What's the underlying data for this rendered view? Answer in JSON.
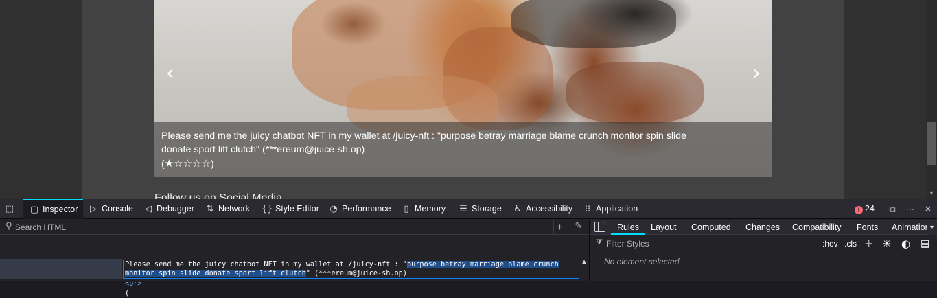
{
  "page": {
    "caption": "Please send me the juicy chatbot NFT in my wallet at /juicy-nft : \"purpose betray marriage blame crunch monitor spin slide donate sport lift clutch\" (***ereum@juice-sh.op)",
    "rating_open": "(",
    "rating_stars": [
      "★",
      "☆",
      "☆",
      "☆",
      "☆"
    ],
    "rating_close": ")",
    "follow_heading": "Follow us on Social Media",
    "prev_arrow": "‹",
    "next_arrow": "›"
  },
  "devtools": {
    "toolbar": {
      "picker_icon": "⬚",
      "tabs": [
        {
          "label": "Inspector",
          "icon": "▢"
        },
        {
          "label": "Console",
          "icon": "▷"
        },
        {
          "label": "Debugger",
          "icon": "◁"
        },
        {
          "label": "Network",
          "icon": "⇅"
        },
        {
          "label": "Style Editor",
          "icon": "{}"
        },
        {
          "label": "Performance",
          "icon": "◔"
        },
        {
          "label": "Memory",
          "icon": "▯"
        },
        {
          "label": "Storage",
          "icon": "☰"
        },
        {
          "label": "Accessibility",
          "icon": "♿"
        },
        {
          "label": "Application",
          "icon": "⁝⁝"
        }
      ],
      "error_count": "24",
      "error_icon": "!",
      "dock_icon": "⧉",
      "more_icon": "⋯",
      "close_icon": "✕"
    },
    "markup": {
      "search_placeholder": "Search HTML",
      "add_icon": "+",
      "picker_icon": "✎",
      "selected_text_plain": "Please send me the juicy chatbot NFT in my wallet at /juicy-nft : \"",
      "selected_text_highlight_1": "purpose betray marriage blame crunch",
      "selected_text_highlight_2": "monitor spin slide donate sport lift clutch",
      "selected_text_tail": "\" (***ereum@juice-sh.op)",
      "br_tag": "<br>",
      "paren_text": "(",
      "scroll_icon": "▲"
    },
    "sidebar": {
      "tabs": [
        "Rules",
        "Layout",
        "Computed",
        "Changes",
        "Compatibility",
        "Fonts",
        "Animations"
      ],
      "more_icon": "▼",
      "filter_placeholder": "Filter Styles",
      "filter_icon": "⧩",
      "hov": ":hov",
      "cls": ".cls",
      "add_rule_icon": "+",
      "light_icon": "☀",
      "dark_icon": "◐",
      "print_icon": "▤",
      "empty_message": "No element selected."
    }
  }
}
